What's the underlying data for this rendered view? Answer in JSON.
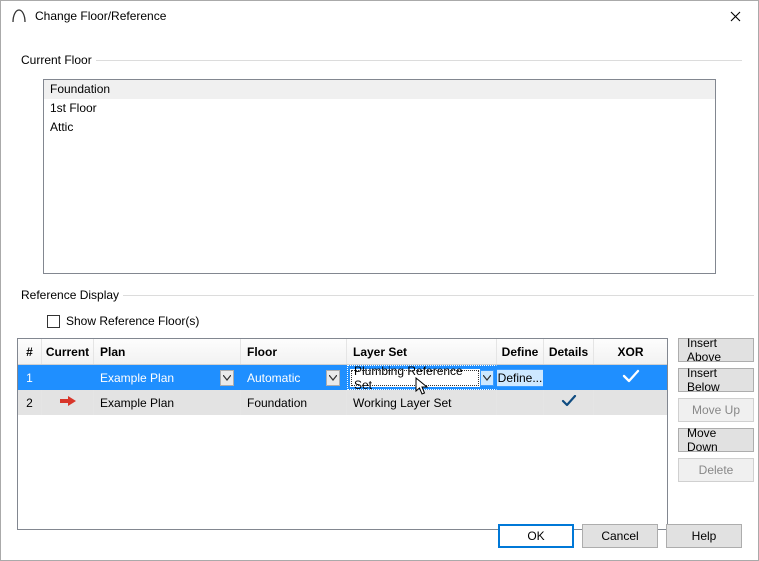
{
  "title": "Change Floor/Reference",
  "group_current_floor": "Current Floor",
  "floors": {
    "f0": "Foundation",
    "f1": "1st Floor",
    "f2": "Attic"
  },
  "group_reference": "Reference Display",
  "checkbox_label": "Show Reference Floor(s)",
  "headers": {
    "num": "#",
    "current": "Current",
    "plan": "Plan",
    "floor": "Floor",
    "layerset": "Layer Set",
    "define": "Define",
    "details": "Details",
    "xor": "XOR"
  },
  "rows": {
    "r1": {
      "num": "1",
      "plan": "Example Plan",
      "floor": "Automatic",
      "layerset": "Plumbing Reference Set",
      "define": "Define..."
    },
    "r2": {
      "num": "2",
      "plan": "Example Plan",
      "floor": "Foundation",
      "layerset": "Working Layer Set"
    }
  },
  "sidebar": {
    "insert_above": "Insert Above",
    "insert_below": "Insert Below",
    "move_up": "Move Up",
    "move_down": "Move Down",
    "delete": "Delete"
  },
  "footer": {
    "ok": "OK",
    "cancel": "Cancel",
    "help": "Help"
  }
}
